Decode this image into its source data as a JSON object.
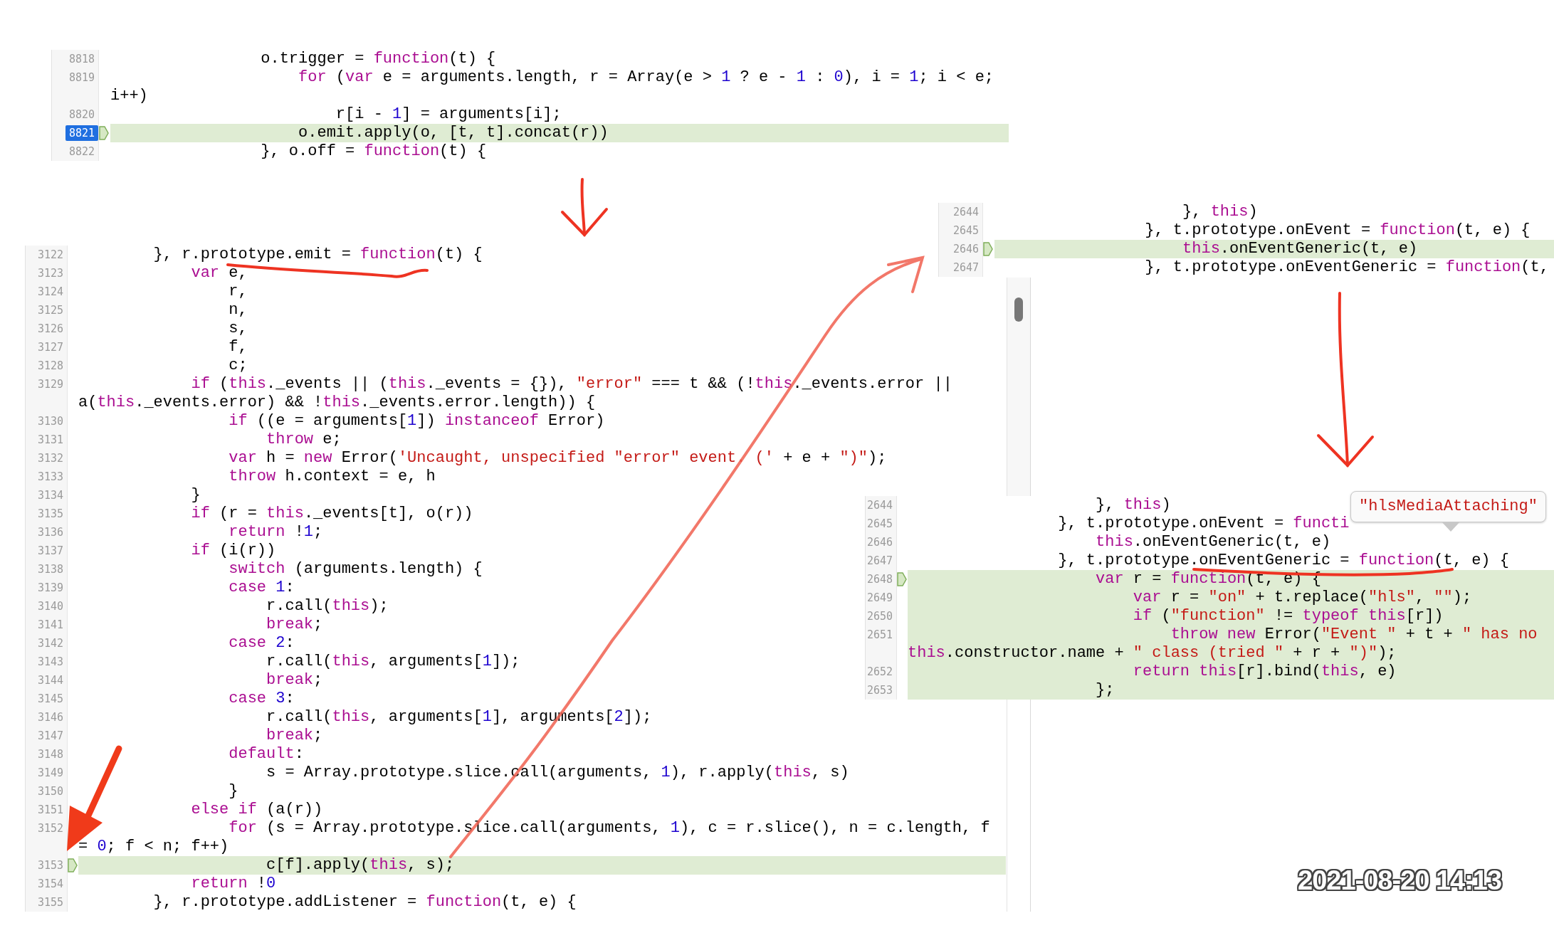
{
  "panels": [
    {
      "lines": [
        {
          "number": "8818",
          "current": false,
          "pointer": false,
          "highlighted": false,
          "code": [
            {
              "kind": "plain",
              "text": "                o.trigger = "
            },
            {
              "kind": "keyword",
              "text": "function"
            },
            {
              "kind": "plain",
              "text": "(t) {"
            }
          ]
        },
        {
          "number": "8819",
          "current": false,
          "pointer": false,
          "highlighted": false,
          "code": [
            {
              "kind": "keyword",
              "text": "                    for"
            },
            {
              "kind": "plain",
              "text": " ("
            },
            {
              "kind": "keyword",
              "text": "var"
            },
            {
              "kind": "plain",
              "text": " e = arguments.length, r = Array(e > "
            },
            {
              "kind": "number",
              "text": "1"
            },
            {
              "kind": "plain",
              "text": " ? e - "
            },
            {
              "kind": "number",
              "text": "1"
            },
            {
              "kind": "plain",
              "text": " : "
            },
            {
              "kind": "number",
              "text": "0"
            },
            {
              "kind": "plain",
              "text": "), i = "
            },
            {
              "kind": "number",
              "text": "1"
            },
            {
              "kind": "plain",
              "text": "; i < e;"
            }
          ]
        },
        {
          "pointer": false,
          "highlighted": false,
          "code": [
            {
              "kind": "plain",
              "text": "i++)"
            }
          ]
        },
        {
          "number": "8820",
          "current": false,
          "pointer": false,
          "highlighted": false,
          "code": [
            {
              "kind": "plain",
              "text": "                        r[i - "
            },
            {
              "kind": "number",
              "text": "1"
            },
            {
              "kind": "plain",
              "text": "] = arguments[i];"
            }
          ]
        },
        {
          "number": "8821",
          "current": true,
          "pointer": true,
          "highlighted": true,
          "code": [
            {
              "kind": "plain",
              "text": "                    o.emit.apply(o, [t, t].concat(r))"
            }
          ]
        },
        {
          "number": "8822",
          "current": false,
          "pointer": false,
          "highlighted": false,
          "code": [
            {
              "kind": "plain",
              "text": "                }, o.off = "
            },
            {
              "kind": "keyword",
              "text": "function"
            },
            {
              "kind": "plain",
              "text": "(t) {"
            }
          ]
        }
      ]
    },
    {
      "lines": [
        {
          "number": "3122",
          "current": false,
          "pointer": false,
          "highlighted": false,
          "code": [
            {
              "kind": "plain",
              "text": "        }, r.prototype.emit = "
            },
            {
              "kind": "keyword",
              "text": "function"
            },
            {
              "kind": "plain",
              "text": "(t) {"
            }
          ]
        },
        {
          "number": "3123",
          "current": false,
          "pointer": false,
          "highlighted": false,
          "code": [
            {
              "kind": "keyword",
              "text": "            var"
            },
            {
              "kind": "plain",
              "text": " e,"
            }
          ]
        },
        {
          "number": "3124",
          "current": false,
          "pointer": false,
          "highlighted": false,
          "code": [
            {
              "kind": "plain",
              "text": "                r,"
            }
          ]
        },
        {
          "number": "3125",
          "current": false,
          "pointer": false,
          "highlighted": false,
          "code": [
            {
              "kind": "plain",
              "text": "                n,"
            }
          ]
        },
        {
          "number": "3126",
          "current": false,
          "pointer": false,
          "highlighted": false,
          "code": [
            {
              "kind": "plain",
              "text": "                s,"
            }
          ]
        },
        {
          "number": "3127",
          "current": false,
          "pointer": false,
          "highlighted": false,
          "code": [
            {
              "kind": "plain",
              "text": "                f,"
            }
          ]
        },
        {
          "number": "3128",
          "current": false,
          "pointer": false,
          "highlighted": false,
          "code": [
            {
              "kind": "plain",
              "text": "                c;"
            }
          ]
        },
        {
          "number": "3129",
          "current": false,
          "pointer": false,
          "highlighted": false,
          "code": [
            {
              "kind": "keyword",
              "text": "            if"
            },
            {
              "kind": "plain",
              "text": " ("
            },
            {
              "kind": "keyword",
              "text": "this"
            },
            {
              "kind": "plain",
              "text": "._events || ("
            },
            {
              "kind": "keyword",
              "text": "this"
            },
            {
              "kind": "plain",
              "text": "._events = {}), "
            },
            {
              "kind": "string",
              "text": "\"error\""
            },
            {
              "kind": "plain",
              "text": " === t && (!"
            },
            {
              "kind": "keyword",
              "text": "this"
            },
            {
              "kind": "plain",
              "text": "._events.error ||"
            }
          ]
        },
        {
          "pointer": false,
          "highlighted": false,
          "code": [
            {
              "kind": "plain",
              "text": "a("
            },
            {
              "kind": "keyword",
              "text": "this"
            },
            {
              "kind": "plain",
              "text": "._events.error) && !"
            },
            {
              "kind": "keyword",
              "text": "this"
            },
            {
              "kind": "plain",
              "text": "._events.error.length)) {"
            }
          ]
        },
        {
          "number": "3130",
          "current": false,
          "pointer": false,
          "highlighted": false,
          "code": [
            {
              "kind": "keyword",
              "text": "                if"
            },
            {
              "kind": "plain",
              "text": " ((e = arguments["
            },
            {
              "kind": "number",
              "text": "1"
            },
            {
              "kind": "plain",
              "text": "]) "
            },
            {
              "kind": "keyword",
              "text": "instanceof"
            },
            {
              "kind": "plain",
              "text": " Error)"
            }
          ]
        },
        {
          "number": "3131",
          "current": false,
          "pointer": false,
          "highlighted": false,
          "code": [
            {
              "kind": "keyword",
              "text": "                    throw"
            },
            {
              "kind": "plain",
              "text": " e;"
            }
          ]
        },
        {
          "number": "3132",
          "current": false,
          "pointer": false,
          "highlighted": false,
          "code": [
            {
              "kind": "keyword",
              "text": "                var"
            },
            {
              "kind": "plain",
              "text": " h = "
            },
            {
              "kind": "keyword",
              "text": "new"
            },
            {
              "kind": "plain",
              "text": " Error("
            },
            {
              "kind": "string",
              "text": "'Uncaught, unspecified \"error\" event. ('"
            },
            {
              "kind": "plain",
              "text": " + e + "
            },
            {
              "kind": "string",
              "text": "\")\""
            },
            {
              "kind": "plain",
              "text": ");"
            }
          ]
        },
        {
          "number": "3133",
          "current": false,
          "pointer": false,
          "highlighted": false,
          "code": [
            {
              "kind": "keyword",
              "text": "                throw"
            },
            {
              "kind": "plain",
              "text": " h.context = e, h"
            }
          ]
        },
        {
          "number": "3134",
          "current": false,
          "pointer": false,
          "highlighted": false,
          "code": [
            {
              "kind": "plain",
              "text": "            }"
            }
          ]
        },
        {
          "number": "3135",
          "current": false,
          "pointer": false,
          "highlighted": false,
          "code": [
            {
              "kind": "keyword",
              "text": "            if"
            },
            {
              "kind": "plain",
              "text": " (r = "
            },
            {
              "kind": "keyword",
              "text": "this"
            },
            {
              "kind": "plain",
              "text": "._events[t], o(r))"
            }
          ]
        },
        {
          "number": "3136",
          "current": false,
          "pointer": false,
          "highlighted": false,
          "code": [
            {
              "kind": "keyword",
              "text": "                return"
            },
            {
              "kind": "plain",
              "text": " !"
            },
            {
              "kind": "number",
              "text": "1"
            },
            {
              "kind": "plain",
              "text": ";"
            }
          ]
        },
        {
          "number": "3137",
          "current": false,
          "pointer": false,
          "highlighted": false,
          "code": [
            {
              "kind": "keyword",
              "text": "            if"
            },
            {
              "kind": "plain",
              "text": " (i(r))"
            }
          ]
        },
        {
          "number": "3138",
          "current": false,
          "pointer": false,
          "highlighted": false,
          "code": [
            {
              "kind": "keyword",
              "text": "                switch"
            },
            {
              "kind": "plain",
              "text": " (arguments.length) {"
            }
          ]
        },
        {
          "number": "3139",
          "current": false,
          "pointer": false,
          "highlighted": false,
          "code": [
            {
              "kind": "keyword",
              "text": "                case"
            },
            {
              "kind": "number",
              "text": " 1"
            },
            {
              "kind": "plain",
              "text": ":"
            }
          ]
        },
        {
          "number": "3140",
          "current": false,
          "pointer": false,
          "highlighted": false,
          "code": [
            {
              "kind": "plain",
              "text": "                    r.call("
            },
            {
              "kind": "keyword",
              "text": "this"
            },
            {
              "kind": "plain",
              "text": ");"
            }
          ]
        },
        {
          "number": "3141",
          "current": false,
          "pointer": false,
          "highlighted": false,
          "code": [
            {
              "kind": "keyword",
              "text": "                    break"
            },
            {
              "kind": "plain",
              "text": ";"
            }
          ]
        },
        {
          "number": "3142",
          "current": false,
          "pointer": false,
          "highlighted": false,
          "code": [
            {
              "kind": "keyword",
              "text": "                case"
            },
            {
              "kind": "number",
              "text": " 2"
            },
            {
              "kind": "plain",
              "text": ":"
            }
          ]
        },
        {
          "number": "3143",
          "current": false,
          "pointer": false,
          "highlighted": false,
          "code": [
            {
              "kind": "plain",
              "text": "                    r.call("
            },
            {
              "kind": "keyword",
              "text": "this"
            },
            {
              "kind": "plain",
              "text": ", arguments["
            },
            {
              "kind": "number",
              "text": "1"
            },
            {
              "kind": "plain",
              "text": "]);"
            }
          ]
        },
        {
          "number": "3144",
          "current": false,
          "pointer": false,
          "highlighted": false,
          "code": [
            {
              "kind": "keyword",
              "text": "                    break"
            },
            {
              "kind": "plain",
              "text": ";"
            }
          ]
        },
        {
          "number": "3145",
          "current": false,
          "pointer": false,
          "highlighted": false,
          "code": [
            {
              "kind": "keyword",
              "text": "                case"
            },
            {
              "kind": "number",
              "text": " 3"
            },
            {
              "kind": "plain",
              "text": ":"
            }
          ]
        },
        {
          "number": "3146",
          "current": false,
          "pointer": false,
          "highlighted": false,
          "code": [
            {
              "kind": "plain",
              "text": "                    r.call("
            },
            {
              "kind": "keyword",
              "text": "this"
            },
            {
              "kind": "plain",
              "text": ", arguments["
            },
            {
              "kind": "number",
              "text": "1"
            },
            {
              "kind": "plain",
              "text": "], arguments["
            },
            {
              "kind": "number",
              "text": "2"
            },
            {
              "kind": "plain",
              "text": "]);"
            }
          ]
        },
        {
          "number": "3147",
          "current": false,
          "pointer": false,
          "highlighted": false,
          "code": [
            {
              "kind": "keyword",
              "text": "                    break"
            },
            {
              "kind": "plain",
              "text": ";"
            }
          ]
        },
        {
          "number": "3148",
          "current": false,
          "pointer": false,
          "highlighted": false,
          "code": [
            {
              "kind": "keyword",
              "text": "                default"
            },
            {
              "kind": "plain",
              "text": ":"
            }
          ]
        },
        {
          "number": "3149",
          "current": false,
          "pointer": false,
          "highlighted": false,
          "code": [
            {
              "kind": "plain",
              "text": "                    s = Array.prototype.slice.call(arguments, "
            },
            {
              "kind": "number",
              "text": "1"
            },
            {
              "kind": "plain",
              "text": "), r.apply("
            },
            {
              "kind": "keyword",
              "text": "this"
            },
            {
              "kind": "plain",
              "text": ", s)"
            }
          ]
        },
        {
          "number": "3150",
          "current": false,
          "pointer": false,
          "highlighted": false,
          "code": [
            {
              "kind": "plain",
              "text": "                }"
            }
          ]
        },
        {
          "number": "3151",
          "current": false,
          "pointer": false,
          "highlighted": false,
          "code": [
            {
              "kind": "keyword",
              "text": "            else"
            },
            {
              "kind": "keyword",
              "text": " if"
            },
            {
              "kind": "plain",
              "text": " (a(r))"
            }
          ]
        },
        {
          "number": "3152",
          "current": false,
          "pointer": false,
          "highlighted": false,
          "code": [
            {
              "kind": "keyword",
              "text": "                for"
            },
            {
              "kind": "plain",
              "text": " (s = Array.prototype.slice.call(arguments, "
            },
            {
              "kind": "number",
              "text": "1"
            },
            {
              "kind": "plain",
              "text": "), c = r.slice(), n = c.length, f"
            }
          ]
        },
        {
          "pointer": false,
          "highlighted": false,
          "code": [
            {
              "kind": "plain",
              "text": "= "
            },
            {
              "kind": "number",
              "text": "0"
            },
            {
              "kind": "plain",
              "text": "; f < n; f++)"
            }
          ]
        },
        {
          "number": "3153",
          "current": false,
          "pointer": true,
          "highlighted": true,
          "code": [
            {
              "kind": "plain",
              "text": "                    c[f].apply("
            },
            {
              "kind": "keyword",
              "text": "this"
            },
            {
              "kind": "plain",
              "text": ", s);"
            }
          ]
        },
        {
          "number": "3154",
          "current": false,
          "pointer": false,
          "highlighted": false,
          "code": [
            {
              "kind": "keyword",
              "text": "            return"
            },
            {
              "kind": "plain",
              "text": " !"
            },
            {
              "kind": "number",
              "text": "0"
            }
          ]
        },
        {
          "number": "3155",
          "current": false,
          "pointer": false,
          "highlighted": false,
          "code": [
            {
              "kind": "plain",
              "text": "        }, r.prototype.addListener = "
            },
            {
              "kind": "keyword",
              "text": "function"
            },
            {
              "kind": "plain",
              "text": "(t, e) {"
            }
          ]
        }
      ]
    },
    {
      "lines": [
        {
          "number": "2644",
          "current": false,
          "pointer": false,
          "highlighted": false,
          "code": [
            {
              "kind": "plain",
              "text": "                    }, "
            },
            {
              "kind": "keyword",
              "text": "this"
            },
            {
              "kind": "plain",
              "text": ")"
            }
          ]
        },
        {
          "number": "2645",
          "current": false,
          "pointer": false,
          "highlighted": false,
          "code": [
            {
              "kind": "plain",
              "text": "                }, t.prototype.onEvent = "
            },
            {
              "kind": "keyword",
              "text": "function"
            },
            {
              "kind": "plain",
              "text": "(t, e) {"
            }
          ]
        },
        {
          "number": "2646",
          "current": false,
          "pointer": true,
          "highlighted": true,
          "code": [
            {
              "kind": "keyword",
              "text": "                    this"
            },
            {
              "kind": "plain",
              "text": ".onEventGeneric(t, e)"
            }
          ]
        },
        {
          "number": "2647",
          "current": false,
          "pointer": false,
          "highlighted": false,
          "code": [
            {
              "kind": "plain",
              "text": "                }, t.prototype.onEventGeneric = "
            },
            {
              "kind": "keyword",
              "text": "function"
            },
            {
              "kind": "plain",
              "text": "(t,"
            }
          ]
        }
      ]
    },
    {
      "lines": [
        {
          "number": "2644",
          "current": false,
          "pointer": false,
          "highlighted": false,
          "code": [
            {
              "kind": "plain",
              "text": "                    }, "
            },
            {
              "kind": "keyword",
              "text": "this"
            },
            {
              "kind": "plain",
              "text": ")"
            }
          ]
        },
        {
          "number": "2645",
          "current": false,
          "pointer": false,
          "highlighted": false,
          "code": [
            {
              "kind": "plain",
              "text": "                }, t.prototype.onEvent = "
            },
            {
              "kind": "keyword",
              "text": "functi"
            }
          ]
        },
        {
          "number": "2646",
          "current": false,
          "pointer": false,
          "highlighted": false,
          "code": [
            {
              "kind": "keyword",
              "text": "                    this"
            },
            {
              "kind": "plain",
              "text": ".onEventGeneric(t, e)"
            }
          ]
        },
        {
          "number": "2647",
          "current": false,
          "pointer": false,
          "highlighted": false,
          "code": [
            {
              "kind": "plain",
              "text": "                }, t.prototype.onEventGeneric = "
            },
            {
              "kind": "keyword",
              "text": "function"
            },
            {
              "kind": "plain",
              "text": "(t, e) {"
            }
          ]
        },
        {
          "number": "2648",
          "current": false,
          "pointer": true,
          "highlighted": true,
          "code": [
            {
              "kind": "keyword",
              "text": "                    var"
            },
            {
              "kind": "plain",
              "text": " r = "
            },
            {
              "kind": "keyword",
              "text": "function"
            },
            {
              "kind": "plain",
              "text": "(t, e) {"
            }
          ]
        },
        {
          "number": "2649",
          "current": false,
          "pointer": false,
          "highlighted": true,
          "code": [
            {
              "kind": "keyword",
              "text": "                        var"
            },
            {
              "kind": "plain",
              "text": " r = "
            },
            {
              "kind": "string",
              "text": "\"on\""
            },
            {
              "kind": "plain",
              "text": " + t.replace("
            },
            {
              "kind": "string",
              "text": "\"hls\""
            },
            {
              "kind": "plain",
              "text": ", "
            },
            {
              "kind": "string",
              "text": "\"\""
            },
            {
              "kind": "plain",
              "text": ");"
            }
          ]
        },
        {
          "number": "2650",
          "current": false,
          "pointer": false,
          "highlighted": true,
          "code": [
            {
              "kind": "keyword",
              "text": "                        if"
            },
            {
              "kind": "plain",
              "text": " ("
            },
            {
              "kind": "string",
              "text": "\"function\""
            },
            {
              "kind": "plain",
              "text": " != "
            },
            {
              "kind": "keyword",
              "text": "typeof"
            },
            {
              "kind": "keyword",
              "text": " this"
            },
            {
              "kind": "plain",
              "text": "[r])"
            }
          ]
        },
        {
          "number": "2651",
          "current": false,
          "pointer": false,
          "highlighted": true,
          "code": [
            {
              "kind": "keyword",
              "text": "                            throw"
            },
            {
              "kind": "keyword",
              "text": " new"
            },
            {
              "kind": "plain",
              "text": " Error("
            },
            {
              "kind": "string",
              "text": "\"Event \""
            },
            {
              "kind": "plain",
              "text": " + t + "
            },
            {
              "kind": "string",
              "text": "\" has no"
            }
          ]
        },
        {
          "pointer": false,
          "highlighted": true,
          "code": [
            {
              "kind": "keyword",
              "text": "this"
            },
            {
              "kind": "plain",
              "text": ".constructor.name + "
            },
            {
              "kind": "string",
              "text": "\" class (tried \""
            },
            {
              "kind": "plain",
              "text": " + r + "
            },
            {
              "kind": "string",
              "text": "\")\""
            },
            {
              "kind": "plain",
              "text": ");"
            }
          ]
        },
        {
          "number": "2652",
          "current": false,
          "pointer": false,
          "highlighted": true,
          "code": [
            {
              "kind": "keyword",
              "text": "                        return"
            },
            {
              "kind": "keyword",
              "text": " this"
            },
            {
              "kind": "plain",
              "text": "[r].bind("
            },
            {
              "kind": "keyword",
              "text": "this"
            },
            {
              "kind": "plain",
              "text": ", e)"
            }
          ]
        },
        {
          "number": "2653",
          "current": false,
          "pointer": false,
          "highlighted": true,
          "code": [
            {
              "kind": "plain",
              "text": "                    };"
            }
          ]
        }
      ]
    }
  ],
  "tooltip": {
    "text": "\"hlsMediaAttaching\""
  },
  "timestamp": "2021-08-20 14:13"
}
